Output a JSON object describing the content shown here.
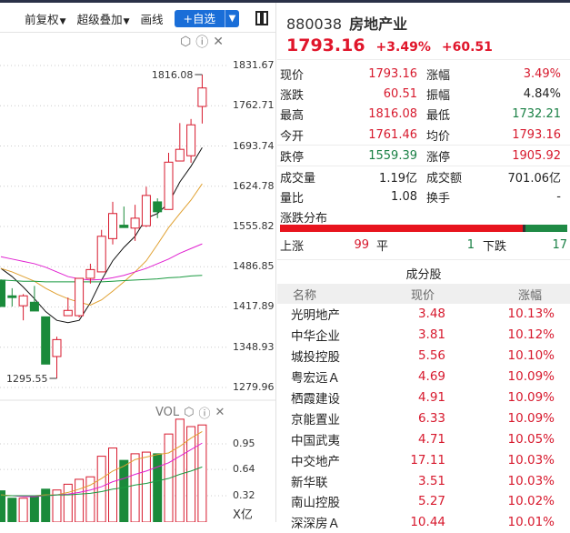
{
  "toolbar": {
    "fq": "前复权",
    "overlay": "超级叠加",
    "draw": "画线",
    "add": "+自选"
  },
  "chart_data": {
    "type": "candlestick",
    "price_axis": {
      "ticks": [
        "1831.67",
        "1762.71",
        "1693.74",
        "1624.78",
        "1555.82",
        "1486.85",
        "1417.89",
        "1348.93",
        "1279.96"
      ],
      "range": [
        1279.96,
        1831.67
      ]
    },
    "high_label": "1816.08",
    "low_label": "1295.55",
    "candles": [
      [
        1463.9,
        1418.7,
        1465,
        1418.7
      ],
      [
        1437,
        1434,
        1450,
        1418.7
      ],
      [
        1420,
        1437,
        1440,
        1395
      ],
      [
        1426,
        1411,
        1454,
        1411
      ],
      [
        1401,
        1320,
        1401,
        1320
      ],
      [
        1333,
        1362,
        1367,
        1295.55
      ],
      [
        1403,
        1412,
        1434,
        1403
      ],
      [
        1403,
        1467,
        1467,
        1400
      ],
      [
        1467,
        1482,
        1492,
        1458
      ],
      [
        1478,
        1539,
        1550,
        1478
      ],
      [
        1535,
        1578,
        1598,
        1525
      ],
      [
        1558,
        1554,
        1590,
        1554
      ],
      [
        1553,
        1570,
        1593,
        1531
      ],
      [
        1557,
        1609,
        1624,
        1555
      ],
      [
        1598,
        1581,
        1604,
        1570
      ],
      [
        1585,
        1666,
        1682,
        1585
      ],
      [
        1668,
        1688,
        1733,
        1668
      ],
      [
        1677,
        1730,
        1740,
        1665
      ],
      [
        1761.46,
        1793.16,
        1816.08,
        1732.21
      ]
    ],
    "ma": [
      {
        "name": "MA5",
        "color": "#111111",
        "values": [
          1484,
          1470,
          1452,
          1432,
          1410,
          1395,
          1391,
          1395,
          1425,
          1464,
          1497,
          1520,
          1539,
          1570,
          1578,
          1596,
          1632,
          1659,
          1691
        ]
      },
      {
        "name": "MA10",
        "color": "#e0a030",
        "values": [
          1484,
          1478,
          1470,
          1462,
          1450,
          1440,
          1432,
          1426,
          1421,
          1430,
          1445,
          1461,
          1478,
          1497,
          1525,
          1554,
          1578,
          1601,
          1629
        ]
      },
      {
        "name": "MA20",
        "color": "#e020d0",
        "values": [
          1504,
          1500,
          1496,
          1492,
          1486,
          1478,
          1470,
          1466,
          1464,
          1465,
          1468,
          1472,
          1478,
          1484,
          1492,
          1500,
          1510,
          1518,
          1526
        ]
      },
      {
        "name": "MA60",
        "color": "#1a9a40",
        "values": [
          1464,
          1463,
          1462,
          1462,
          1461,
          1461,
          1461,
          1461,
          1461,
          1461,
          1462,
          1463,
          1464,
          1465,
          1466,
          1468,
          1469,
          1471,
          1472
        ]
      }
    ],
    "vol": {
      "label": "VOL",
      "unit": "X亿",
      "ticks": [
        "0.95",
        "0.64",
        "0.32"
      ],
      "range": [
        0,
        1.25
      ],
      "values": [
        0.38,
        0.29,
        0.29,
        0.31,
        0.4,
        0.39,
        0.46,
        0.52,
        0.55,
        0.8,
        0.9,
        0.75,
        0.83,
        0.85,
        0.83,
        1.07,
        1.25,
        1.16,
        1.18
      ],
      "ma": [
        {
          "color": "#e0a030",
          "values": [
            0.33,
            0.32,
            0.32,
            0.32,
            0.33,
            0.33,
            0.36,
            0.4,
            0.45,
            0.53,
            0.62,
            0.68,
            0.76,
            0.79,
            0.82,
            0.84,
            0.92,
            1.02,
            1.1
          ]
        },
        {
          "color": "#e020d0",
          "values": [
            0.32,
            0.32,
            0.31,
            0.31,
            0.32,
            0.33,
            0.34,
            0.36,
            0.39,
            0.43,
            0.49,
            0.53,
            0.58,
            0.62,
            0.67,
            0.72,
            0.8,
            0.88,
            0.96
          ]
        },
        {
          "color": "#1a9a40",
          "values": [
            0.32,
            0.32,
            0.32,
            0.32,
            0.32,
            0.33,
            0.33,
            0.34,
            0.35,
            0.37,
            0.4,
            0.42,
            0.45,
            0.47,
            0.5,
            0.53,
            0.58,
            0.62,
            0.67
          ]
        }
      ]
    }
  },
  "quote": {
    "code": "880038",
    "name": "房地产业",
    "price": "1793.16",
    "pct": "+3.49%",
    "chg": "+60.51"
  },
  "stats": [
    [
      {
        "l": "现价",
        "v": "1793.16",
        "c": "red"
      },
      {
        "l": "涨幅",
        "v": "3.49%",
        "c": "red"
      }
    ],
    [
      {
        "l": "涨跌",
        "v": "60.51",
        "c": "red"
      },
      {
        "l": "振幅",
        "v": "4.84%",
        "c": ""
      }
    ],
    [
      {
        "l": "最高",
        "v": "1816.08",
        "c": "red"
      },
      {
        "l": "最低",
        "v": "1732.21",
        "c": "green"
      }
    ],
    [
      {
        "l": "今开",
        "v": "1761.46",
        "c": "red"
      },
      {
        "l": "均价",
        "v": "1793.16",
        "c": "red"
      }
    ],
    [
      {
        "l": "跌停",
        "v": "1559.39",
        "c": "green"
      },
      {
        "l": "涨停",
        "v": "1905.92",
        "c": "red"
      }
    ],
    [
      {
        "l": "成交量",
        "v": "1.19亿",
        "c": ""
      },
      {
        "l": "成交额",
        "v": "701.06亿",
        "c": ""
      }
    ],
    [
      {
        "l": "量比",
        "v": "1.08",
        "c": ""
      },
      {
        "l": "换手",
        "v": "-",
        "c": ""
      }
    ]
  ],
  "distribution": {
    "title": "涨跌分布",
    "up_label": "上涨",
    "up": 99,
    "flat_label": "平",
    "flat": 1,
    "down_label": "下跌",
    "down": 17
  },
  "constituents": {
    "title": "成分股",
    "headers": [
      "名称",
      "现价",
      "涨幅"
    ],
    "rows": [
      [
        "光明地产",
        "3.48",
        "10.13%"
      ],
      [
        "中华企业",
        "3.81",
        "10.12%"
      ],
      [
        "城投控股",
        "5.56",
        "10.10%"
      ],
      [
        "粤宏远Ａ",
        "4.69",
        "10.09%"
      ],
      [
        "栖霞建设",
        "4.91",
        "10.09%"
      ],
      [
        "京能置业",
        "6.33",
        "10.09%"
      ],
      [
        "中国武夷",
        "4.71",
        "10.05%"
      ],
      [
        "中交地产",
        "17.11",
        "10.03%"
      ],
      [
        "新华联",
        "3.51",
        "10.03%"
      ],
      [
        "南山控股",
        "5.27",
        "10.02%"
      ],
      [
        "深深房Ａ",
        "10.44",
        "10.01%"
      ]
    ]
  }
}
